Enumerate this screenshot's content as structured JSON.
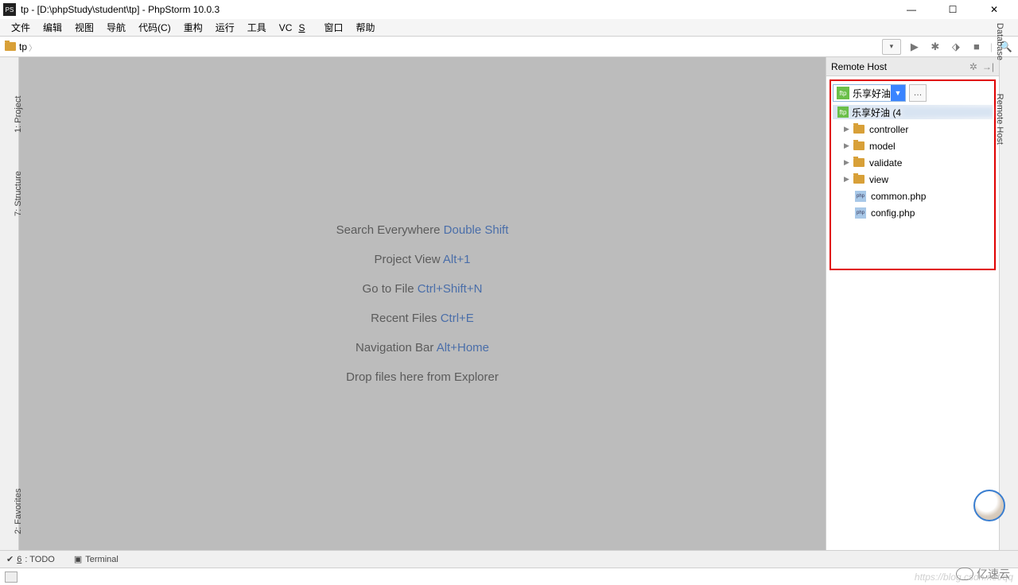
{
  "title": "tp - [D:\\phpStudy\\student\\tp] - PhpStorm 10.0.3",
  "menu": [
    "文件",
    "编辑",
    "视图",
    "导航",
    "代码(C)",
    "重构",
    "运行",
    "工具",
    "VCS",
    "窗口",
    "帮助"
  ],
  "breadcrumb": {
    "root": "tp"
  },
  "hints": [
    {
      "label": "Search Everywhere",
      "shortcut": "Double Shift"
    },
    {
      "label": "Project View",
      "shortcut": "Alt+1"
    },
    {
      "label": "Go to File",
      "shortcut": "Ctrl+Shift+N"
    },
    {
      "label": "Recent Files",
      "shortcut": "Ctrl+E"
    },
    {
      "label": "Navigation Bar",
      "shortcut": "Alt+Home"
    }
  ],
  "drop_hint": "Drop files here from Explorer",
  "left_tabs": {
    "project": "1: Project",
    "structure": "7: Structure"
  },
  "right_tabs": {
    "database": "Database",
    "remote": "Remote Host"
  },
  "bottom_tabs": {
    "todo": "6: TODO",
    "terminal": "Terminal"
  },
  "remote": {
    "title": "Remote Host",
    "server": "乐享好油",
    "root_label": "乐享好油 (4",
    "folders": [
      "controller",
      "model",
      "validate",
      "view"
    ],
    "files": [
      "common.php",
      "config.php"
    ]
  },
  "watermark_url": "https://blog.csdn.net/qq",
  "footer_brand": "亿速云"
}
